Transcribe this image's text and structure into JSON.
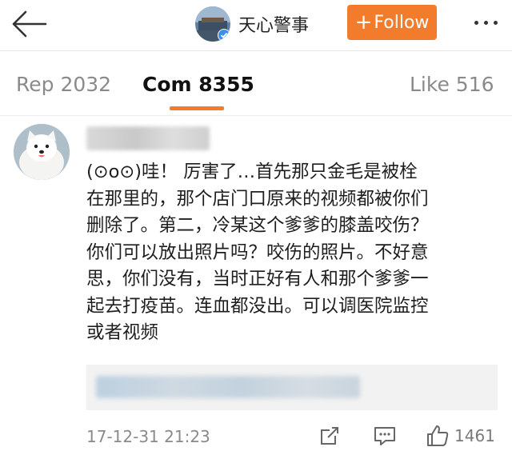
{
  "header": {
    "account_name": "天心警事",
    "follow_label": "Follow",
    "follow_plus": "+"
  },
  "tabs": [
    {
      "label": "Rep 2032"
    },
    {
      "label": "Com 8355"
    },
    {
      "label": "Like 516"
    }
  ],
  "comment": {
    "lines": [
      "(⊙o⊙)哇！ 厉害了…首先那只金毛是被栓",
      "在那里的，那个店门口原来的视频都被你们",
      "删除了。第二，冷某这个爹爹的膝盖咬伤？",
      "你们可以放出照片吗？咬伤的照片。不好意",
      "思，你们没有，当时正好有人和那个爹爹一",
      "起去打疫苗。连血都没出。可以调医院监控",
      "或者视频"
    ],
    "timestamp": "17-12-31 21:23",
    "like_count": "1461"
  },
  "colors": {
    "accent": "#f27c2b",
    "muted_text": "#8a8a8a",
    "quote_bg": "#f2f2f2"
  },
  "icons": [
    "back-arrow-icon",
    "verified-badge-icon",
    "more-dots-icon",
    "share-icon",
    "reply-icon",
    "like-icon"
  ]
}
